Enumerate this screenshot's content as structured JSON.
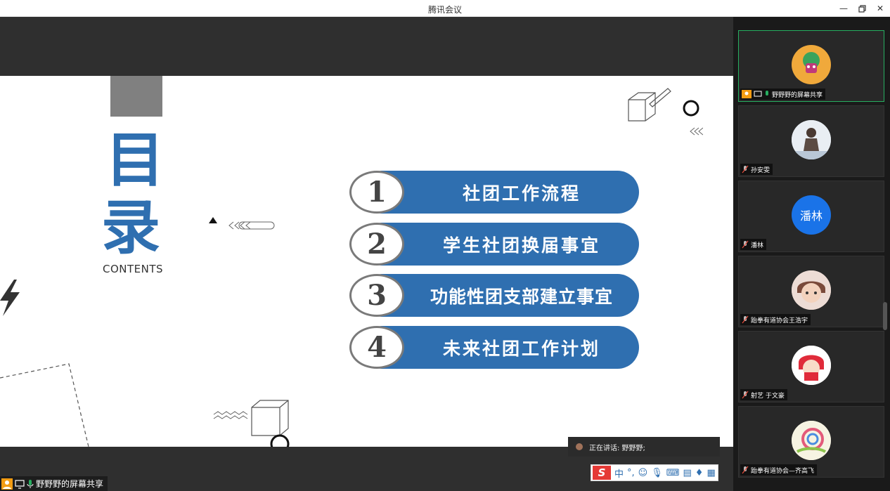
{
  "window": {
    "title": "腾讯会议"
  },
  "slide": {
    "heading_chars": [
      "目",
      "录"
    ],
    "heading_sub": "CONTENTS",
    "items": [
      {
        "num": "1",
        "label": "社团工作流程"
      },
      {
        "num": "2",
        "label": "学生社团换届事宜"
      },
      {
        "num": "3",
        "label": "功能性团支部建立事宜"
      },
      {
        "num": "4",
        "label": "未来社团工作计划"
      }
    ],
    "accent_color": "#2f6fb0"
  },
  "share_badge": {
    "label": "野野野的屏幕共享"
  },
  "speaking": {
    "text": "正在讲话: 野野野;"
  },
  "ime": {
    "logo": "S",
    "mode": "中"
  },
  "participants": [
    {
      "name": "野野野的屏幕共享",
      "avatar": "cartoon"
    },
    {
      "name": "孙安雯",
      "avatar": "photo"
    },
    {
      "name": "潘林",
      "avatar_text": "潘林",
      "avatar": "text"
    },
    {
      "name": "跆拳有道协会王浩宇",
      "avatar": "cartoon"
    },
    {
      "name": "射艺 于文豪",
      "avatar": "cartoon"
    },
    {
      "name": "跆拳有道协会—齐高飞",
      "avatar": "cartoon"
    }
  ],
  "colors": {
    "speaker_green": "#27ae60",
    "panlin_blue": "#1a73e8"
  }
}
